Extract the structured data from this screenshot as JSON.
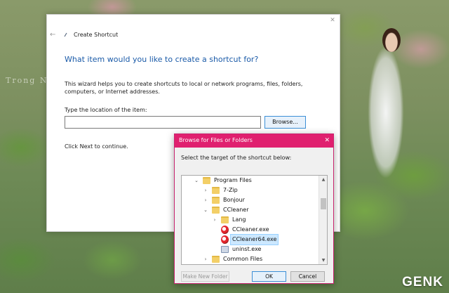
{
  "desktop": {
    "watermark_left": "Trong N",
    "brand": "GENK"
  },
  "wizard": {
    "title": "Create Shortcut",
    "heading": "What item would you like to create a shortcut for?",
    "description": "This wizard helps you to create shortcuts to local or network programs, files, folders, computers, or Internet addresses.",
    "location_label": "Type the location of the item:",
    "location_value": "",
    "browse_label": "Browse...",
    "next_hint": "Click Next to continue."
  },
  "browse_dialog": {
    "title": "Browse for Files or Folders",
    "instruction": "Select the target of the shortcut below:",
    "tree": [
      {
        "label": "Program Files",
        "icon": "folder-icon",
        "toggle": "expanded",
        "depth": 0
      },
      {
        "label": "7-Zip",
        "icon": "folder-icon",
        "toggle": "collapsed",
        "depth": 1
      },
      {
        "label": "Bonjour",
        "icon": "folder-icon",
        "toggle": "collapsed",
        "depth": 1
      },
      {
        "label": "CCleaner",
        "icon": "folder-icon",
        "toggle": "expanded",
        "depth": 1
      },
      {
        "label": "Lang",
        "icon": "folder-icon",
        "toggle": "collapsed",
        "depth": 2
      },
      {
        "label": "CCleaner.exe",
        "icon": "ccleaner-icon",
        "toggle": "none",
        "depth": 2
      },
      {
        "label": "CCleaner64.exe",
        "icon": "ccleaner-icon",
        "toggle": "none",
        "depth": 2,
        "selected": true
      },
      {
        "label": "uninst.exe",
        "icon": "installer-icon",
        "toggle": "none",
        "depth": 2
      },
      {
        "label": "Common Files",
        "icon": "folder-icon",
        "toggle": "collapsed",
        "depth": 1
      }
    ],
    "new_folder_label": "Make New Folder",
    "ok_label": "OK",
    "cancel_label": "Cancel"
  },
  "colors": {
    "dialog_titlebar": "#e0206f",
    "heading_blue": "#1a5aa8",
    "selection": "#cce8ff"
  }
}
